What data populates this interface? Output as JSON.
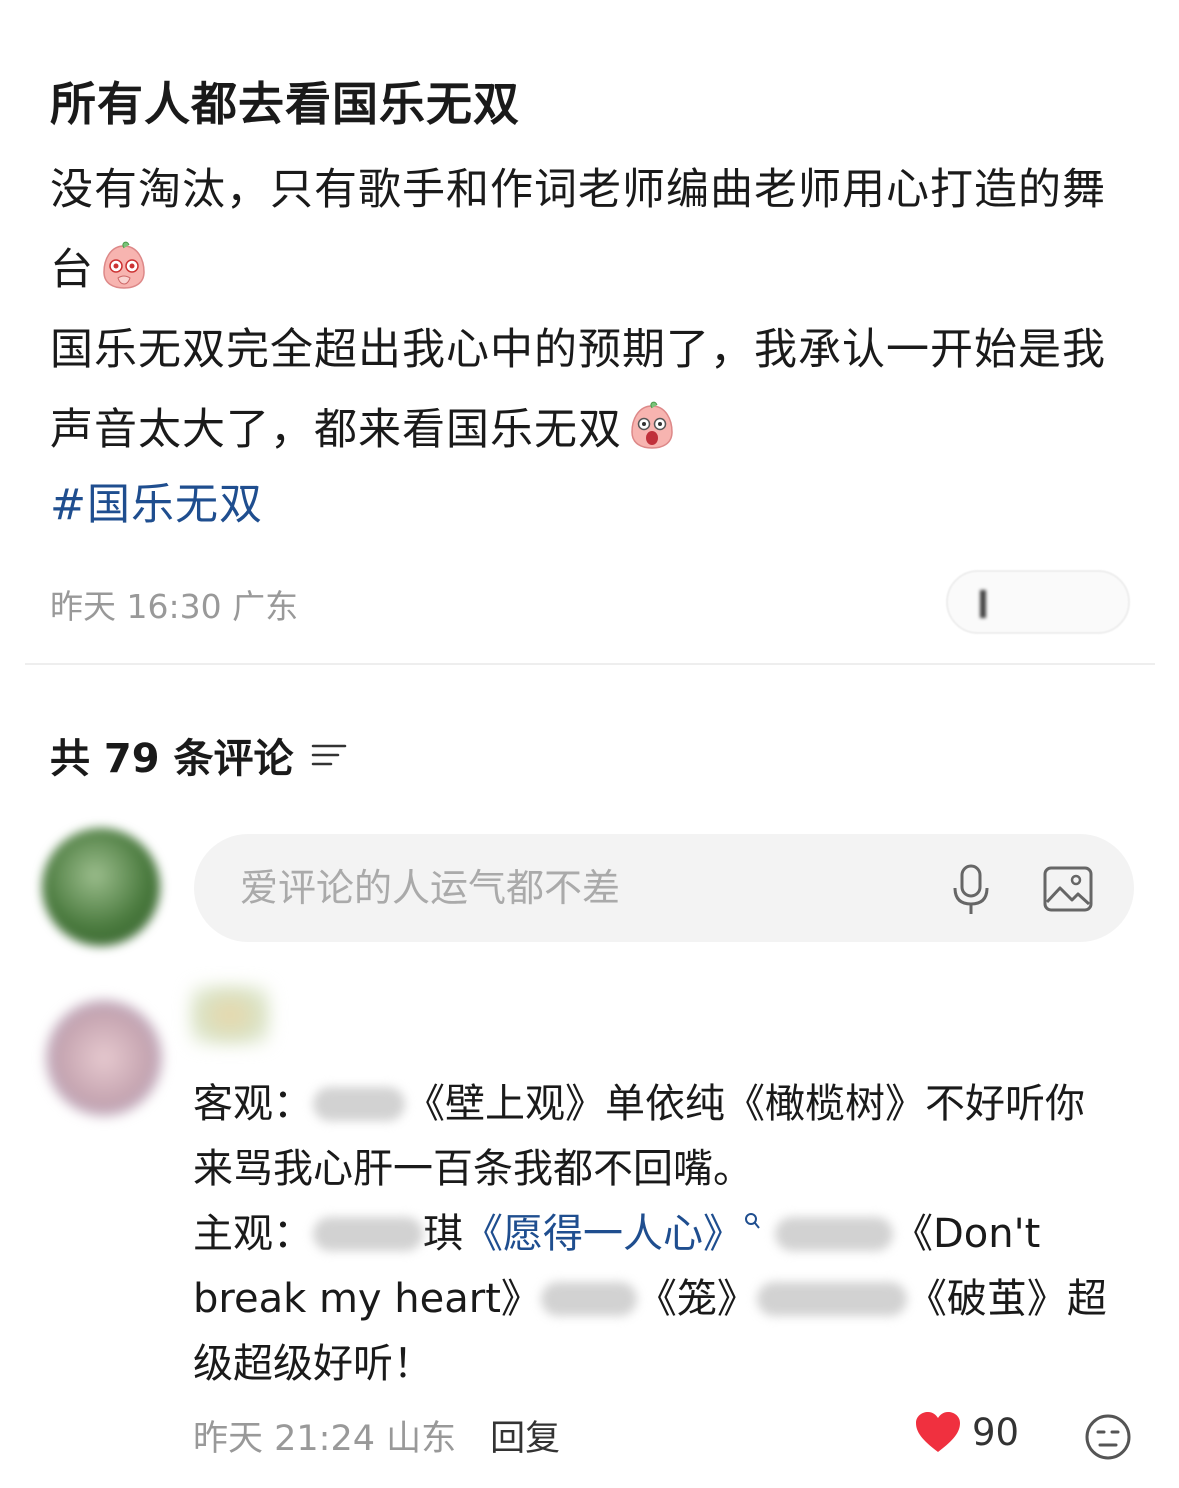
{
  "post": {
    "title": "所有人都去看国乐无双",
    "line1": "没有淘汰，只有歌手和作词老师编曲老师用心打造的舞台",
    "line2": "国乐无双完全超出我心中的预期了，我承认一开始是我声音太大了，都来看国乐无双",
    "hashtag": "#国乐无双",
    "meta": "昨天 16:30 广东",
    "emoji1": "peach-emoji-teary",
    "emoji2": "peach-emoji-shocked"
  },
  "comments_header": {
    "label": "共 79 条评论",
    "icon": "sort-filter-icon"
  },
  "input": {
    "placeholder": "爱评论的人运气都不差",
    "mic_icon": "microphone-icon",
    "image_icon": "image-icon"
  },
  "comment": {
    "p1_prefix": "客观：",
    "p1_song1": "《壁上观》单依纯",
    "p1_song2": "《橄榄树》不好听你来骂我心肝一百条我都不回嘴。",
    "p2_prefix": "主观：",
    "p2_char": "琪",
    "p2_link": "《愿得一人心》",
    "p2_song2a": "《Don't break my heart》",
    "p2_song3": "《笼》",
    "p2_song4": "《破茧》超级超级好听！",
    "time": "昨天 21:24 山东",
    "reply": "回复",
    "likes": "90"
  },
  "colors": {
    "link": "#1f4e8f",
    "heart": "#f0303f",
    "meta": "#999999"
  }
}
